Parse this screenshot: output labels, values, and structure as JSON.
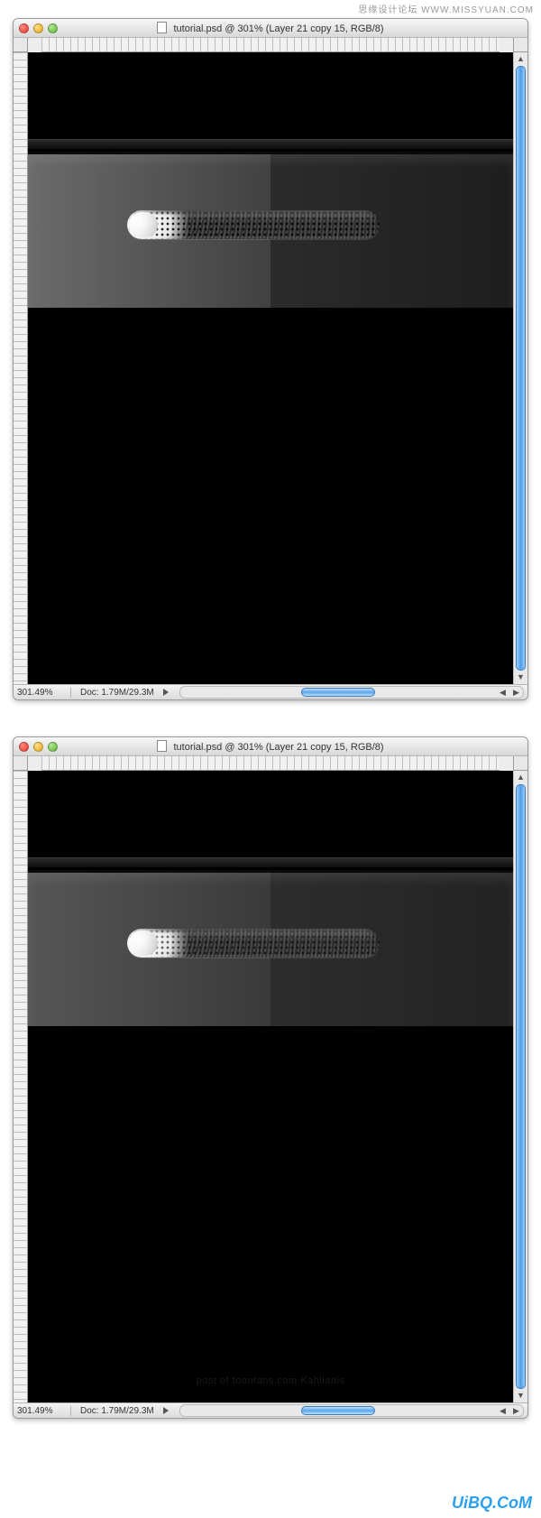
{
  "watermark_top": "思缘设计论坛  WWW.MISSYUAN.COM",
  "watermark_bottom": "UiBQ.CoM",
  "windows": [
    {
      "title": "tutorial.psd @ 301% (Layer 21 copy 15, RGB/8)",
      "zoom": "301.49%",
      "doc_info": "Doc: 1.79M/29.3M",
      "credit": ""
    },
    {
      "title": "tutorial.psd @ 301% (Layer 21 copy 15, RGB/8)",
      "zoom": "301.49%",
      "doc_info": "Doc: 1.79M/29.3M",
      "credit": "post of toonfans.com Kahlianis"
    }
  ]
}
